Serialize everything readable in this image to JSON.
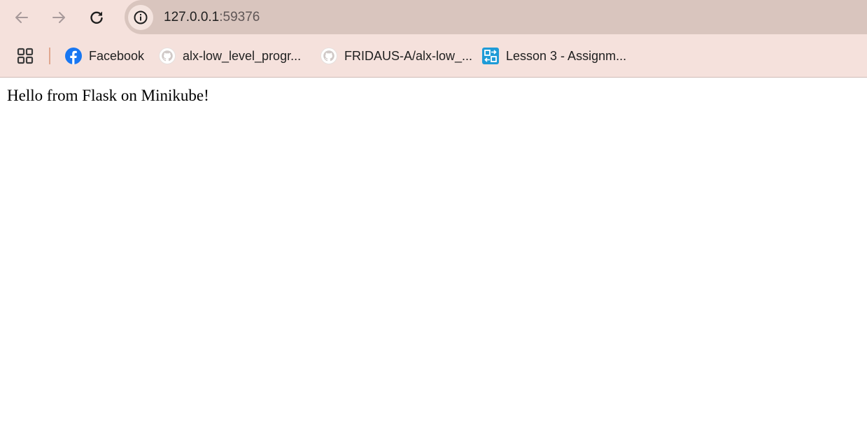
{
  "colors": {
    "toolbar_bg": "#f5e1dc",
    "omnibox_bg": "#d9c5be",
    "bookmark_separator": "#e0a78f",
    "facebook_blue": "#1877f2"
  },
  "toolbar": {
    "back_icon": "arrow-left-icon",
    "forward_icon": "arrow-right-icon",
    "reload_icon": "reload-icon"
  },
  "address_bar": {
    "site_info_icon": "info-icon",
    "host": "127.0.0.1",
    "port": ":59376"
  },
  "bookmarks_bar": {
    "apps_icon": "apps-grid-icon",
    "items": [
      {
        "label": "Facebook",
        "icon": "facebook-icon"
      },
      {
        "label": "alx-low_level_progr...",
        "icon": "github-icon"
      },
      {
        "label": "FRIDAUS-A/alx-low_...",
        "icon": "github-icon"
      },
      {
        "label": "Lesson 3 - Assignm...",
        "icon": "lms-icon"
      }
    ]
  },
  "page": {
    "body_text": "Hello from Flask on Minikube!"
  }
}
